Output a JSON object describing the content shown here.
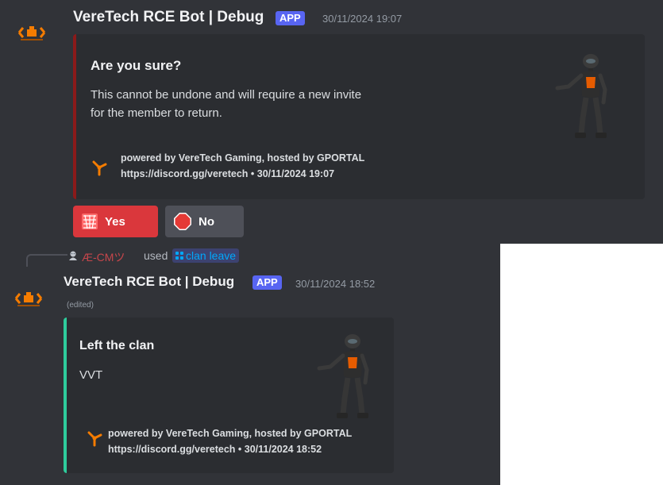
{
  "colors": {
    "background": "#313338",
    "embed_background": "#2b2d31",
    "embed_bar_confirm": "#8b1a1a",
    "embed_bar_success": "#2ecc9c",
    "danger": "#da373c",
    "secondary": "#4e5058",
    "app_badge": "#5865f2",
    "accent_orange": "#f57c00"
  },
  "message1": {
    "author": "VereTech RCE Bot | Debug",
    "badge": "APP",
    "timestamp": "30/11/2024 19:07",
    "embed": {
      "title": "Are you sure?",
      "description_line1": "This cannot be undone and will require a new invite",
      "description_line2": "for the member to return.",
      "footer_line1": "powered by VereTech Gaming, hosted by GPORTAL",
      "footer_line2": "https://discord.gg/veretech • 30/11/2024 19:07",
      "thumbnail_icon": "robot-icon"
    },
    "buttons": [
      {
        "label": "Yes",
        "icon": "net-icon"
      },
      {
        "label": "No",
        "icon": "stop-sign-icon"
      }
    ]
  },
  "message2": {
    "reply": {
      "user": "Æ-CMツ",
      "verb": "used",
      "command": "clan leave"
    },
    "author": "VereTech RCE Bot | Debug",
    "badge": "APP",
    "timestamp": "30/11/2024 18:52",
    "edited": "(edited)",
    "embed": {
      "title": "Left the clan",
      "description": "VVT",
      "footer_line1": "powered by VereTech Gaming, hosted by GPORTAL",
      "footer_line2": "https://discord.gg/veretech • 30/11/2024 18:52",
      "thumbnail_icon": "robot-icon"
    }
  }
}
